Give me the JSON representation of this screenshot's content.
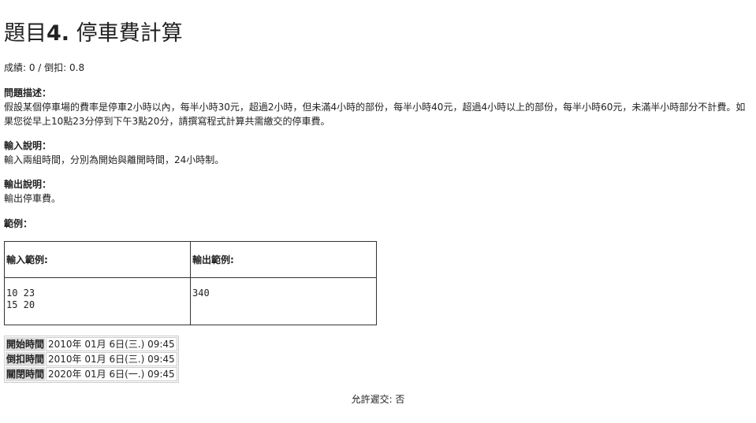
{
  "problem": {
    "title_prefix": "題目",
    "title_number": "4.",
    "title_name": "停車費計算",
    "score_text": "成績: 0 / 倒扣: 0.8"
  },
  "description": {
    "label": "問題描述：",
    "text": "假設某個停車場的費率是停車2小時以內，每半小時30元，超過2小時，但未滿4小時的部份，每半小時40元，超過4小時以上的部份，每半小時60元，未滿半小時部分不計費。如果您從早上10點23分停到下午3點20分，請撰寫程式計算共需繳交的停車費。"
  },
  "input_desc": {
    "label": "輸入說明：",
    "text": "輸入兩組時間，分別為開始與離開時間，24小時制。"
  },
  "output_desc": {
    "label": "輸出說明：",
    "text": "輸出停車費。"
  },
  "example": {
    "label": "範例：",
    "input_header": "輸入範例:",
    "output_header": "輸出範例:",
    "input_value": "10 23\n15 20",
    "output_value": "340"
  },
  "times": [
    {
      "label": "開始時間",
      "value": "2010年 01月 6日(三.) 09:45"
    },
    {
      "label": "倒扣時間",
      "value": "2010年 01月 6日(三.) 09:45"
    },
    {
      "label": "關閉時間",
      "value": "2020年 01月 6日(一.) 09:45"
    }
  ],
  "allow_late": "允許遲交: 否"
}
